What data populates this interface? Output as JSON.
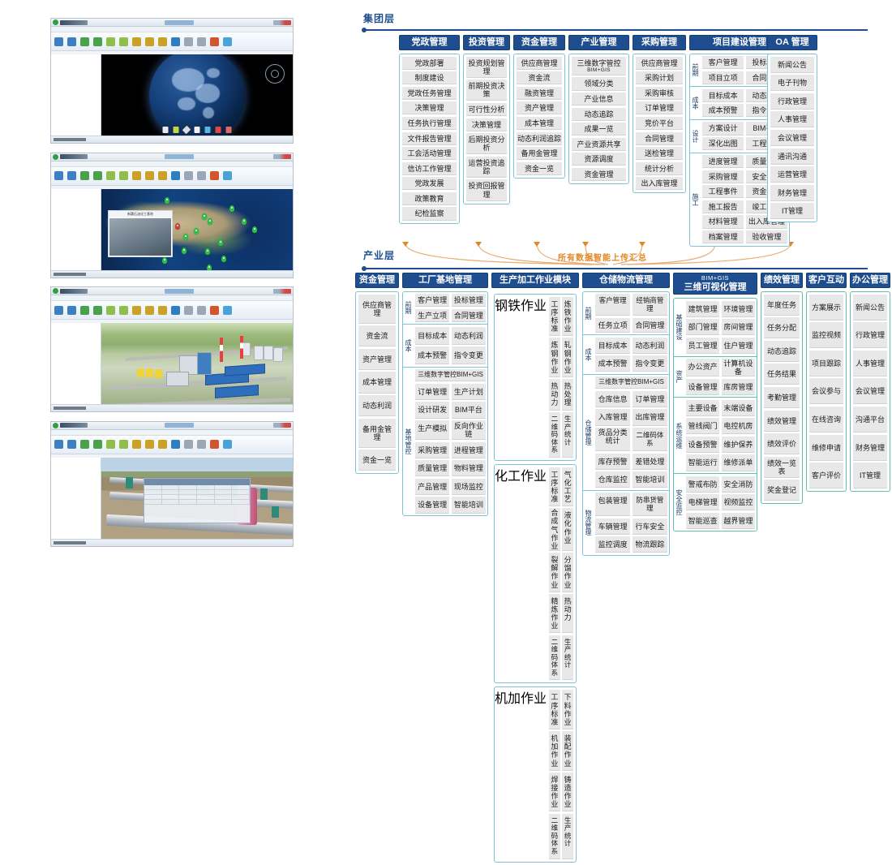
{
  "screenshots": [
    {
      "name": "globe-3d-earth-view",
      "caption": ""
    },
    {
      "name": "china-map-bases-view",
      "caption": "新疆石油化工基地"
    },
    {
      "name": "plant-3d-overview",
      "caption": ""
    },
    {
      "name": "pipeline-equipment-detail",
      "caption": ""
    }
  ],
  "diagram": {
    "group_layer": {
      "label": "集团层",
      "groups": [
        {
          "title": "党政管理",
          "items": [
            "党政部署",
            "制度建设",
            "党政任务管理",
            "决策管理",
            "任务执行管理",
            "文件报告管理",
            "工会活动管理",
            "信访工作管理",
            "党政发展",
            "政策教育",
            "纪检监察"
          ]
        },
        {
          "title": "投资管理",
          "items": [
            "投资规划管理",
            "前期投资决策",
            "可行性分析",
            "决策管理",
            "后期投资分析",
            "运营投资追踪",
            "投资回报管理"
          ]
        },
        {
          "title": "资金管理",
          "items": [
            "供应商管理",
            "资金流",
            "融资管理",
            "资产管理",
            "成本管理",
            "动态利润追踪",
            "备用金管理",
            "资金一览"
          ]
        },
        {
          "title": "产业管理",
          "items": [
            "三维数字管控",
            "领域分类",
            "产业信息",
            "动态追踪",
            "成果一览",
            "产业资源共享",
            "资源调度",
            "资金管理"
          ],
          "first_item_sub": "BIM+GIS"
        },
        {
          "title": "采购管理",
          "items": [
            "供应商管理",
            "采购计划",
            "采购审核",
            "订单管理",
            "竞价平台",
            "合同管理",
            "送检管理",
            "统计分析",
            "出入库管理"
          ]
        },
        {
          "title": "项目建设管理",
          "segments": [
            {
              "side": "前期",
              "cells": [
                "客户管理",
                "投标管理",
                "项目立项",
                "合同管理"
              ]
            },
            {
              "side": "成本",
              "cells": [
                "目标成本",
                "动态利润",
                "成本预警",
                "指令变更"
              ]
            },
            {
              "side": "设计",
              "cells": [
                "方案设计",
                "BIM平台",
                "深化出图",
                "工程预算"
              ]
            },
            {
              "side": "施工",
              "cells": [
                "进度管理",
                "质量管理",
                "采购管理",
                "安全管理",
                "工程事件",
                "资金管理",
                "施工报告",
                "竣工管理",
                "材料管理",
                "出入库管理",
                "档案管理",
                "验收管理"
              ]
            }
          ]
        },
        {
          "title": "OA 管理",
          "items": [
            "新闻公告",
            "电子刊物",
            "行政管理",
            "人事管理",
            "会议管理",
            "通讯沟通",
            "运营管理",
            "财务管理",
            "IT管理"
          ]
        }
      ]
    },
    "flow_note": "所有数据智能上传汇总",
    "industry_layer": {
      "label": "产业层",
      "groups": [
        {
          "title": "资金管理",
          "items": [
            "供应商管理",
            "资金流",
            "资产管理",
            "成本管理",
            "动态利润",
            "备用金管理",
            "资金一览"
          ]
        },
        {
          "title": "工厂基地管理",
          "segments": [
            {
              "side": "前期",
              "cells": [
                "客户管理",
                "投标管理",
                "生产立项",
                "合同管理"
              ]
            },
            {
              "side": "成本",
              "cells": [
                "目标成本",
                "动态利润",
                "成本预警",
                "指令变更"
              ]
            },
            {
              "side": "基地管控",
              "cells": [
                "三维数字管控BIM+GIS",
                "订单管理",
                "生产计划",
                "设计研发",
                "BIM平台",
                "生产模拟",
                "反向作业链",
                "采购管理",
                "进程管理",
                "质量管理",
                "物料管理",
                "产品管理",
                "现场监控",
                "设备管理",
                "智能培训"
              ],
              "first_full": true
            }
          ]
        },
        {
          "title": "生产加工作业模块",
          "segments": [
            {
              "side": "钢铁作业",
              "cells": [
                "工序标准",
                "炼铁作业",
                "炼钢作业",
                "轧钢作业",
                "热动力",
                "热处理",
                "二维码体系",
                "生产统计"
              ]
            },
            {
              "side": "化工作业",
              "cells": [
                "工序标准",
                "气化工艺",
                "合成气作业",
                "液化作业",
                "裂解作业",
                "分馏作业",
                "精炼作业",
                "热动力",
                "二维码体系",
                "生产统计"
              ]
            },
            {
              "side": "机加作业",
              "cells": [
                "工序标准",
                "下料作业",
                "机加作业",
                "装配作业",
                "焊接作业",
                "铸造作业",
                "二维码体系",
                "生产统计"
              ]
            }
          ]
        },
        {
          "title": "仓储物流管理",
          "segments": [
            {
              "side": "前期",
              "cells": [
                "客户管理",
                "经销商管理",
                "任务立项",
                "合同管理"
              ]
            },
            {
              "side": "成本",
              "cells": [
                "目标成本",
                "动态利润",
                "成本预警",
                "指令变更"
              ]
            },
            {
              "side": "仓储管理",
              "cells": [
                "三维数字管控BIM+GIS",
                "仓库信息",
                "订单管理",
                "入库管理",
                "出库管理",
                "货品分类统计",
                "二维码体系",
                "库存预警",
                "差错处理",
                "仓库监控",
                "智能培训"
              ],
              "first_full": true
            },
            {
              "side": "物流管理",
              "cells": [
                "包装管理",
                "防串货管理",
                "车辆管理",
                "行车安全",
                "监控调度",
                "物流跟踪"
              ]
            }
          ]
        },
        {
          "title": "三维可视化管理",
          "title_sub": "BIM+GIS",
          "segments": [
            {
              "side": "基础建设",
              "cells": [
                "建筑管理",
                "环境管理",
                "部门管理",
                "房间管理",
                "员工管理",
                "住户管理"
              ]
            },
            {
              "side": "资产",
              "cells": [
                "办公资产",
                "计算机设备",
                "设备管理",
                "库房管理"
              ]
            },
            {
              "side": "系统运维",
              "cells": [
                "主要设备",
                "末端设备",
                "管线阀门",
                "电控机房",
                "设备预警",
                "维护保养",
                "智能运行",
                "维修派单"
              ]
            },
            {
              "side": "安全监控",
              "cells": [
                "警戒布防",
                "安全消防",
                "电梯管理",
                "视频监控",
                "智能巡查",
                "越界管理"
              ]
            }
          ]
        },
        {
          "title": "绩效管理",
          "items": [
            "年度任务",
            "任务分配",
            "动态追踪",
            "任务结果",
            "考勤管理",
            "绩效管理",
            "绩效评价",
            "绩效一览表",
            "奖金登记"
          ]
        },
        {
          "title": "客户互动",
          "items": [
            "方案展示",
            "监控视频",
            "项目跟踪",
            "会议参与",
            "在线咨询",
            "维修申请",
            "客户评价"
          ]
        },
        {
          "title": "办公管理",
          "items": [
            "新闻公告",
            "行政管理",
            "人事管理",
            "会议管理",
            "沟通平台",
            "财务管理",
            "IT管理"
          ]
        }
      ]
    }
  },
  "colors": {
    "header_blue": "#1e4e8f",
    "border_cyan": "#7fc3d6",
    "cell_gray": "#e8e8e8",
    "accent_orange": "#e08828",
    "label_blue": "#1f4e8c"
  }
}
